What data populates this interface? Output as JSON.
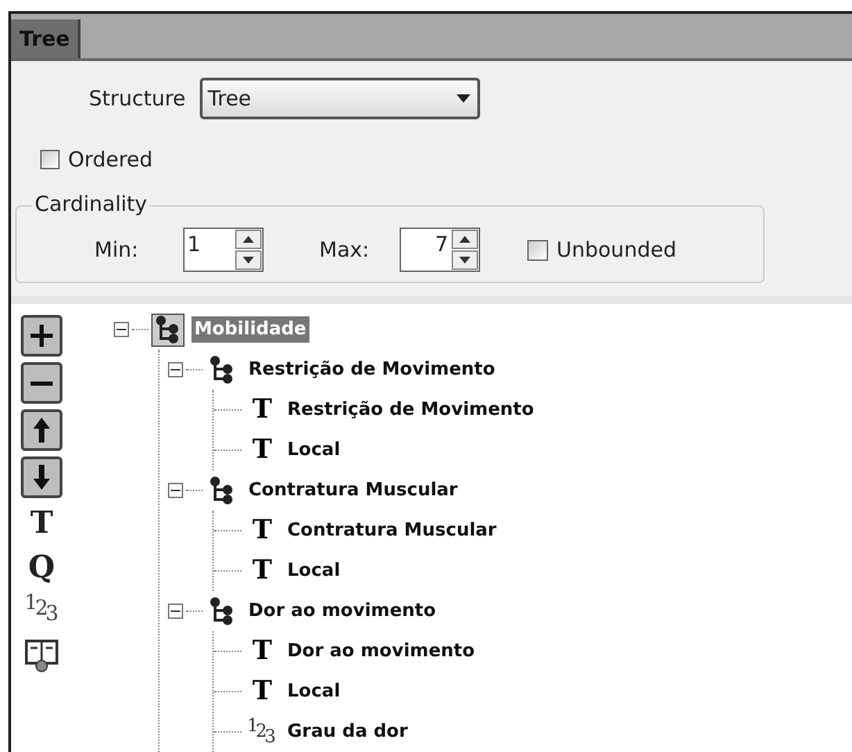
{
  "tabs": [
    {
      "label": "Tree",
      "selected": true
    }
  ],
  "structure": {
    "label": "Structure",
    "value": "Tree"
  },
  "ordered": {
    "label": "Ordered",
    "checked": false
  },
  "cardinality": {
    "title": "Cardinality",
    "min_label": "Min:",
    "min": "1",
    "max_label": "Max:",
    "max": "7",
    "unbounded": {
      "label": "Unbounded",
      "checked": false
    }
  },
  "toolbar": [
    {
      "kind": "plus"
    },
    {
      "kind": "minus"
    },
    {
      "kind": "up"
    },
    {
      "kind": "down"
    },
    {
      "kind": "glyph",
      "text": "T"
    },
    {
      "kind": "glyph",
      "text": "Q"
    },
    {
      "kind": "number",
      "text": "123"
    },
    {
      "kind": "calendar"
    }
  ],
  "tree": [
    {
      "kind": "group",
      "label": "Mobilidade",
      "selected": true,
      "expanded": true,
      "children": [
        {
          "kind": "group",
          "label": "Restrição de Movimento",
          "selected": false,
          "expanded": true,
          "children": [
            {
              "kind": "text",
              "icon": "T",
              "label": "Restrição de Movimento",
              "selected": false
            },
            {
              "kind": "text",
              "icon": "T",
              "label": "Local",
              "selected": false
            }
          ]
        },
        {
          "kind": "group",
          "label": "Contratura Muscular",
          "selected": false,
          "expanded": true,
          "children": [
            {
              "kind": "text",
              "icon": "T",
              "label": "Contratura Muscular",
              "selected": false
            },
            {
              "kind": "text",
              "icon": "T",
              "label": "Local",
              "selected": false
            }
          ]
        },
        {
          "kind": "group",
          "label": "Dor ao movimento",
          "selected": false,
          "expanded": true,
          "children": [
            {
              "kind": "text",
              "icon": "T",
              "label": "Dor ao movimento",
              "selected": false
            },
            {
              "kind": "text",
              "icon": "T",
              "label": "Local",
              "selected": false
            },
            {
              "kind": "number",
              "icon": "123",
              "label": "Grau da dor",
              "selected": false
            }
          ]
        }
      ]
    }
  ]
}
